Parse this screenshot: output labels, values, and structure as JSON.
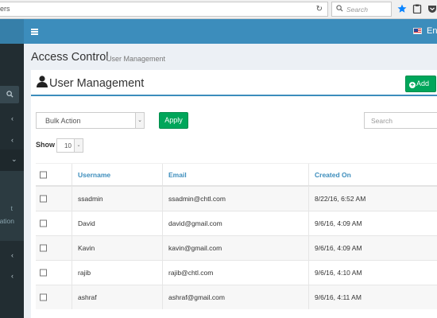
{
  "browser": {
    "url_text": "ers",
    "search_placeholder": "Search"
  },
  "header": {
    "language": "Engl"
  },
  "sidebar": {
    "sub_items": [
      "t",
      "ation"
    ]
  },
  "content": {
    "title": "Access Control",
    "subtitle": "User Management"
  },
  "box": {
    "title": "User Management",
    "add_label": "Add"
  },
  "toolbar": {
    "bulk_action": "Bulk Action",
    "apply_label": "Apply",
    "search_placeholder": "Search",
    "show_label": "Show",
    "show_value": "10"
  },
  "table": {
    "columns": [
      "Username",
      "Email",
      "Created On"
    ],
    "rows": [
      {
        "username": "ssadmin",
        "email": "ssadmin@chtl.com",
        "created": "8/22/16, 6:52 AM"
      },
      {
        "username": "David",
        "email": "david@gmail.com",
        "created": "9/6/16, 4:09 AM"
      },
      {
        "username": "Kavin",
        "email": "kavin@gmail.com",
        "created": "9/6/16, 4:09 AM"
      },
      {
        "username": "rajib",
        "email": "rajib@chtl.com",
        "created": "9/6/16, 4:10 AM"
      },
      {
        "username": "ashraf",
        "email": "ashraf@gmail.com",
        "created": "9/6/16, 4:11 AM"
      }
    ]
  },
  "colors": {
    "header_blue": "#3c8dbc",
    "sidebar_dark": "#222d32",
    "button_green": "#00a65a"
  }
}
